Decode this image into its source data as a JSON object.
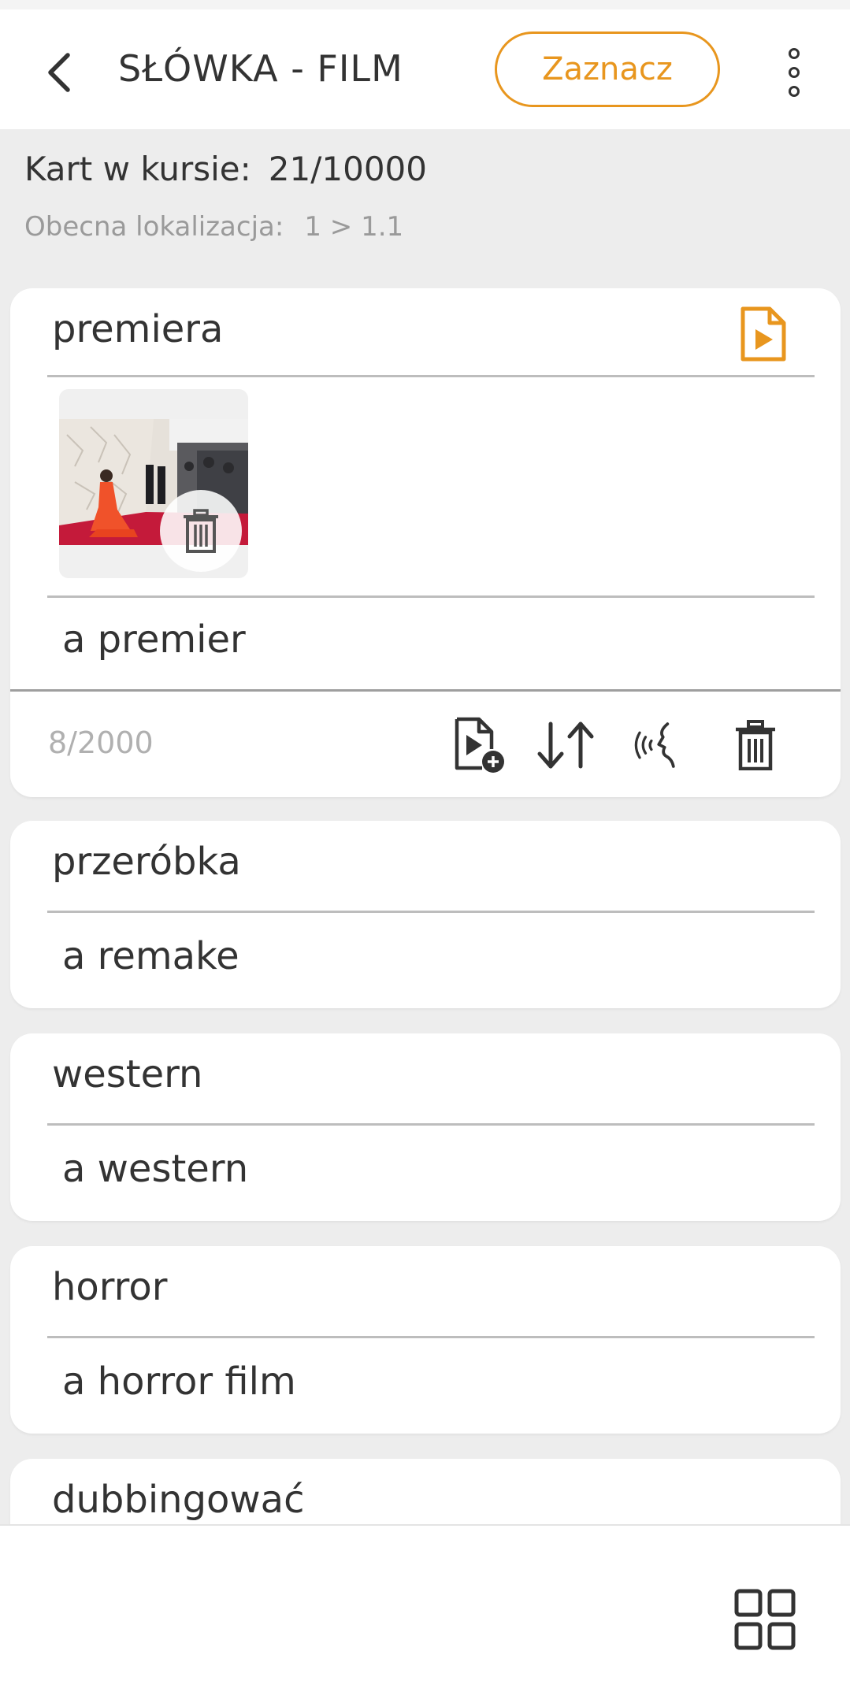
{
  "header": {
    "title": "SŁÓWKA - FILM",
    "mark_button": "Zaznacz",
    "back_icon": "chevron-left-icon",
    "menu_icon": "more-vertical-icon"
  },
  "info": {
    "cards_label": "Kart w kursie:",
    "cards_value": "21/10000",
    "location_label": "Obecna lokalizacja:",
    "location_value": "1 > 1.1"
  },
  "cards": [
    {
      "term": "premiera",
      "definition": "a premier",
      "counter": "8/2000",
      "expanded": true
    },
    {
      "term": "przeróbka",
      "definition": "a remake"
    },
    {
      "term": "western",
      "definition": "a western"
    },
    {
      "term": "horror",
      "definition": "a horror film"
    },
    {
      "term": "dubbingować",
      "definition": ""
    }
  ],
  "card_tools": [
    "add-media-icon",
    "swap-icon",
    "speech-icon",
    "trash-icon"
  ],
  "bottom": {
    "grid_icon": "grid-view-icon"
  },
  "colors": {
    "accent": "#e8961e",
    "background": "#ededed",
    "card": "#ffffff",
    "text": "#333333"
  }
}
